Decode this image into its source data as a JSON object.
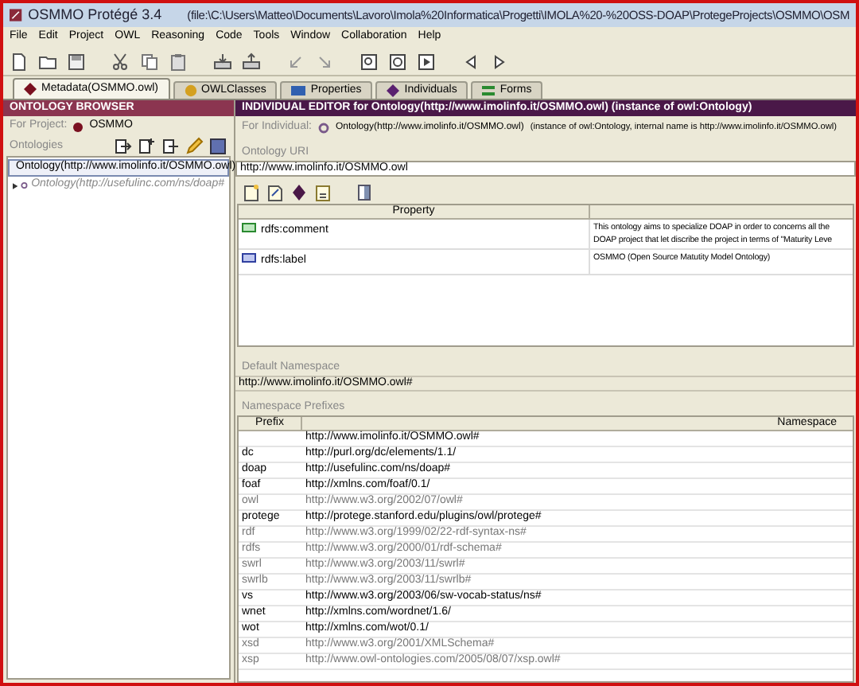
{
  "window": {
    "title": "OSMMO  Protégé 3.4",
    "path": "(file:\\C:\\Users\\Matteo\\Documents\\Lavoro\\Imola%20Informatica\\Progetti\\IMOLA%20-%20OSS-DOAP\\ProtegeProjects\\OSMMO\\OSM"
  },
  "menu": [
    "File",
    "Edit",
    "Project",
    "OWL",
    "Reasoning",
    "Code",
    "Tools",
    "Window",
    "Collaboration",
    "Help"
  ],
  "tabs": [
    {
      "label": "Metadata(OSMMO.owl)",
      "kind": "metadata",
      "selected": true
    },
    {
      "label": "OWLClasses",
      "kind": "classes",
      "selected": false
    },
    {
      "label": "Properties",
      "kind": "properties",
      "selected": false
    },
    {
      "label": "Individuals",
      "kind": "individuals",
      "selected": false
    },
    {
      "label": "Forms",
      "kind": "forms",
      "selected": false
    }
  ],
  "browser": {
    "title": "ONTOLOGY BROWSER",
    "project_label": "For Project:",
    "project": "OSMMO",
    "ontologies_label": "Ontologies",
    "ontologies": [
      {
        "label": "Ontology(http://www.imolinfo.it/OSMMO.owl)",
        "selected": true,
        "greyed": false,
        "expandable": false
      },
      {
        "label": "Ontology(http://usefulinc.com/ns/doap#",
        "selected": false,
        "greyed": true,
        "expandable": true
      }
    ]
  },
  "editor": {
    "title": "INDIVIDUAL EDITOR for Ontology(http://www.imolinfo.it/OSMMO.owl)  (instance of owl:Ontology)",
    "individual_label": "For Individual:",
    "individual": "Ontology(http://www.imolinfo.it/OSMMO.owl)",
    "individual_note": "(instance of owl:Ontology, internal name is http://www.imolinfo.it/OSMMO.owl)",
    "uri_label": "Ontology URI",
    "uri": "http://www.imolinfo.it/OSMMO.owl",
    "properties": {
      "columns": [
        "Property"
      ],
      "rows": [
        {
          "kind": "comment",
          "property": "rdfs:comment",
          "value": [
            "This ontology aims to specialize DOAP in order to concerns all the",
            "DOAP project that let discribe the project in terms of \"Maturity Leve"
          ]
        },
        {
          "kind": "label",
          "property": "rdfs:label",
          "value": [
            "OSMMO (Open Source Matutity Model Ontology)"
          ]
        }
      ]
    },
    "namespace_label": "Default Namespace",
    "namespace": "http://www.imolinfo.it/OSMMO.owl#",
    "prefixes_label": "Namespace Prefixes",
    "prefix_columns": [
      "Prefix",
      "Namespace"
    ],
    "prefixes": [
      {
        "namespace": "http://www.imolinfo.it/OSMMO.owl#",
        "greyed": false
      },
      {
        "prefix": "dc",
        "namespace": "http://purl.org/dc/elements/1.1/",
        "greyed": false
      },
      {
        "prefix": "doap",
        "namespace": "http://usefulinc.com/ns/doap#",
        "greyed": false
      },
      {
        "prefix": "foaf",
        "namespace": "http://xmlns.com/foaf/0.1/",
        "greyed": false
      },
      {
        "prefix": "owl",
        "namespace": "http://www.w3.org/2002/07/owl#",
        "greyed": true
      },
      {
        "prefix": "protege",
        "namespace": "http://protege.stanford.edu/plugins/owl/protege#",
        "greyed": false
      },
      {
        "prefix": "rdf",
        "namespace": "http://www.w3.org/1999/02/22-rdf-syntax-ns#",
        "greyed": true
      },
      {
        "prefix": "rdfs",
        "namespace": "http://www.w3.org/2000/01/rdf-schema#",
        "greyed": true
      },
      {
        "prefix": "swrl",
        "namespace": "http://www.w3.org/2003/11/swrl#",
        "greyed": true
      },
      {
        "prefix": "swrlb",
        "namespace": "http://www.w3.org/2003/11/swrlb#",
        "greyed": true
      },
      {
        "prefix": "vs",
        "namespace": "http://www.w3.org/2003/06/sw-vocab-status/ns#",
        "greyed": false
      },
      {
        "prefix": "wnet",
        "namespace": "http://xmlns.com/wordnet/1.6/",
        "greyed": false
      },
      {
        "prefix": "wot",
        "namespace": "http://xmlns.com/wot/0.1/",
        "greyed": false
      },
      {
        "prefix": "xsd",
        "namespace": "http://www.w3.org/2001/XMLSchema#",
        "greyed": true
      },
      {
        "prefix": "xsp",
        "namespace": "http://www.owl-ontologies.com/2005/08/07/xsp.owl#",
        "greyed": true
      }
    ]
  }
}
